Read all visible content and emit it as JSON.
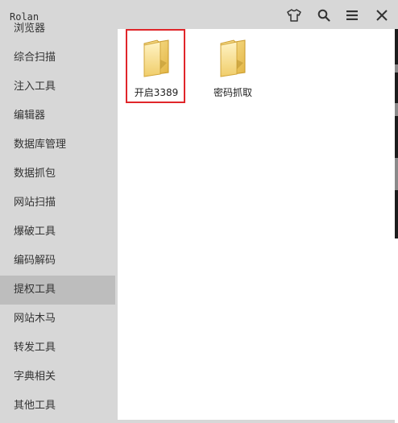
{
  "window": {
    "title": "Rolan",
    "colors": {
      "background": "#d7d7d7",
      "content": "#ffffff",
      "selection_border": "#e0262a",
      "active_item": "#bdbdbd"
    }
  },
  "toolbar": {
    "icons": [
      "shirt-icon",
      "search-icon",
      "menu-icon",
      "close-icon"
    ]
  },
  "sidebar": {
    "items": [
      {
        "label": "浏览器",
        "active": false
      },
      {
        "label": "综合扫描",
        "active": false
      },
      {
        "label": "注入工具",
        "active": false
      },
      {
        "label": "编辑器",
        "active": false
      },
      {
        "label": "数据库管理",
        "active": false
      },
      {
        "label": "数据抓包",
        "active": false
      },
      {
        "label": "网站扫描",
        "active": false
      },
      {
        "label": "爆破工具",
        "active": false
      },
      {
        "label": "编码解码",
        "active": false
      },
      {
        "label": "提权工具",
        "active": true
      },
      {
        "label": "网站木马",
        "active": false
      },
      {
        "label": "转发工具",
        "active": false
      },
      {
        "label": "字典相关",
        "active": false
      },
      {
        "label": "其他工具",
        "active": false
      }
    ]
  },
  "content": {
    "folders": [
      {
        "label": "开启3389",
        "selected": true,
        "icon": "folder-icon"
      },
      {
        "label": "密码抓取",
        "selected": false,
        "icon": "folder-icon"
      }
    ]
  }
}
